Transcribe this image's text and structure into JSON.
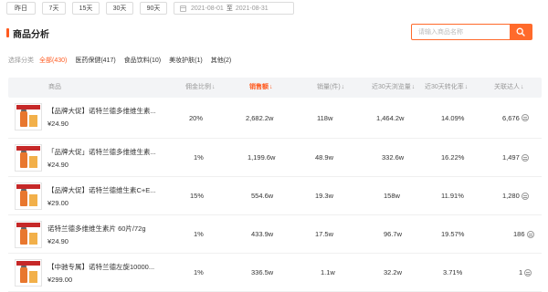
{
  "date_filters": {
    "buttons": [
      "昨日",
      "7天",
      "15天",
      "30天",
      "90天"
    ],
    "start_date": "2021-08-01",
    "separator": "至",
    "end_date": "2021-08-31"
  },
  "section": {
    "title": "商品分析",
    "search_placeholder": "请输入商品名称"
  },
  "categories": {
    "label": "选择分类",
    "items": [
      "全部(430)",
      "医药保健(417)",
      "食品饮料(10)",
      "美妆护肤(1)",
      "其他(2)"
    ],
    "active_index": 0
  },
  "table": {
    "columns": [
      "商品",
      "佣金比例",
      "销售额",
      "销量(件)",
      "近30天浏览量",
      "近30天转化率",
      "关联达人"
    ],
    "sorted_column": "销售额",
    "rows": [
      {
        "name": "【品牌大促】诺特兰德多维维生素...",
        "price": "¥24.90",
        "commission": "20%",
        "sales": "2,682.2w",
        "volume": "118w",
        "views": "1,464.2w",
        "conversion": "14.09%",
        "influencers": "6,676"
      },
      {
        "name": "「品牌大促」诺特兰德多维维生素...",
        "price": "¥24.90",
        "commission": "1%",
        "sales": "1,199.6w",
        "volume": "48.9w",
        "views": "332.6w",
        "conversion": "16.22%",
        "influencers": "1,497"
      },
      {
        "name": "【品牌大促】诺特兰德维生素C+E...",
        "price": "¥29.00",
        "commission": "15%",
        "sales": "554.6w",
        "volume": "19.3w",
        "views": "158w",
        "conversion": "11.91%",
        "influencers": "1,280"
      },
      {
        "name": "诺特兰德多维维生素片 60片/72g",
        "price": "¥24.90",
        "commission": "1%",
        "sales": "433.9w",
        "volume": "17.5w",
        "views": "96.7w",
        "conversion": "19.57%",
        "influencers": "186"
      },
      {
        "name": "【中驰专属】诺特兰德左旋10000...",
        "price": "¥299.00",
        "commission": "1%",
        "sales": "336.5w",
        "volume": "1.1w",
        "views": "32.2w",
        "conversion": "3.71%",
        "influencers": "1"
      }
    ]
  },
  "colors": {
    "accent": "#ff5a1f",
    "header_bg": "#f3f4f6"
  },
  "icons": {
    "calendar": "calendar-icon",
    "search": "search-icon",
    "sort": "sort-down-icon",
    "more": "more-icon"
  }
}
